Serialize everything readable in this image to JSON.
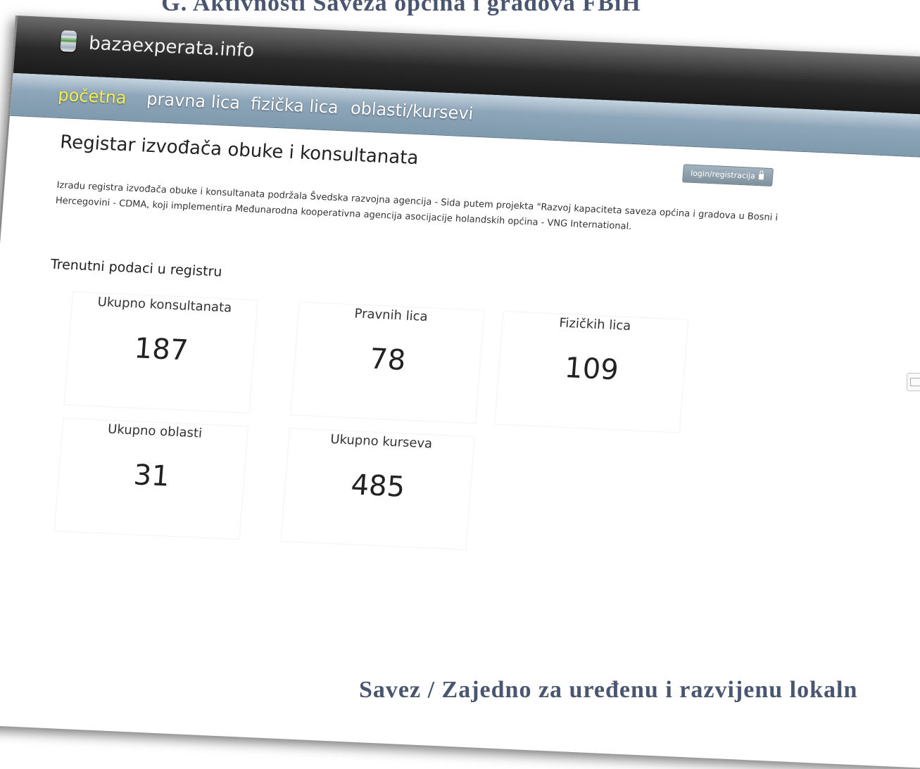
{
  "slide": {
    "title": "G. Aktivnosti Saveza općina i gradova FBiH",
    "footer": "Savez / Zajedno za uređenu i razvijenu lokaln"
  },
  "header": {
    "logo_icon": "database-icon",
    "logo_text": "bazaexperata.info"
  },
  "nav": {
    "items": [
      {
        "label": "početna",
        "active": true
      },
      {
        "label": "pravna lica"
      },
      {
        "label": "fizička lica"
      },
      {
        "label": "oblasti/kursevi"
      }
    ]
  },
  "page": {
    "title": "Registar izvođača obuke i konsultanata",
    "login_label": "login/registracija",
    "login_icon": "lock-icon",
    "intro": "Izradu registra izvođača obuke i konsultanata podržala Švedska razvojna agencija - Sida putem projekta \"Razvoj kapaciteta saveza općina i gradova u Bosni i Hercegovini - CDMA, koji implementira Međunarodna kooperativna agencija asocijacije holandskih općina - VNG International.",
    "section_title": "Trenutni podaci u registru"
  },
  "stats": [
    {
      "label": "Ukupno konsultanata",
      "value": "187"
    },
    {
      "label": "Pravnih lica",
      "value": "78"
    },
    {
      "label": "Fizičkih lica",
      "value": "109"
    },
    {
      "label": "Ukupno oblasti",
      "value": "31"
    },
    {
      "label": "Ukupno kurseva",
      "value": "485"
    }
  ],
  "side_button_icon": "mail-icon",
  "colors": {
    "header_dark": "#1b1b1b",
    "nav_blue": "#8ea6b9",
    "nav_active": "#f5f04a",
    "slide_text": "#4a5570"
  }
}
